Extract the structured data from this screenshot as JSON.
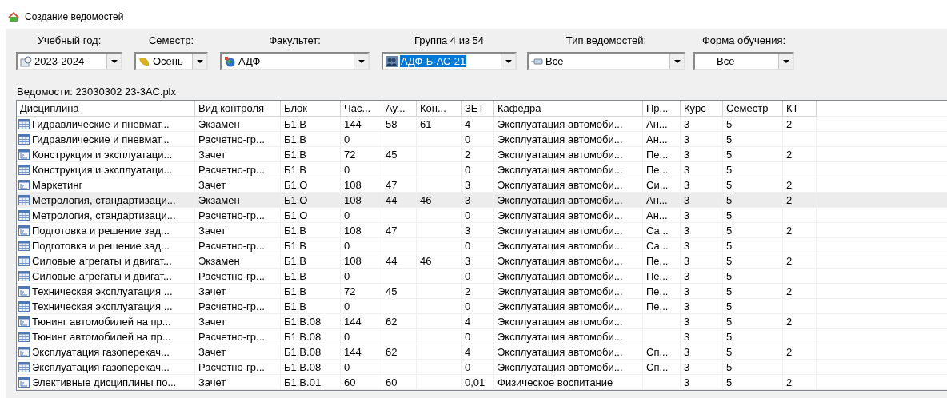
{
  "window": {
    "title": "Создание ведомостей"
  },
  "filters": {
    "year": {
      "label": "Учебный год:",
      "value": "2023-2024"
    },
    "semester": {
      "label": "Семестр:",
      "value": "Осень"
    },
    "faculty": {
      "label": "Факультет:",
      "value": "АДФ"
    },
    "group": {
      "label": "Группа 4 из 54",
      "value": "АДФ-Б-АС-21",
      "focused": true
    },
    "sheet_type": {
      "label": "Тип ведомостей:",
      "value": "Все"
    },
    "study_form": {
      "label": "Форма обучения:",
      "value": "Все"
    }
  },
  "file_caption": "Ведомости:  23030302  23-3АС.plx",
  "table": {
    "columns": [
      "Дисциплина",
      "Вид контроля",
      "Блок",
      "Час...",
      "Ау...",
      "Кон...",
      "ЗЕТ",
      "Кафедра",
      "Пр...",
      "Курс",
      "Семестр",
      "КТ"
    ],
    "rows": [
      {
        "kind": "grid",
        "selected": false,
        "cells": [
          "Гидравлические и пневмат...",
          "Экзамен",
          "Б1.В",
          "144",
          "58",
          "61",
          "4",
          "Эксплуатация автомоби...",
          "Ан...",
          "3",
          "5",
          "2"
        ]
      },
      {
        "kind": "grid",
        "selected": false,
        "cells": [
          "Гидравлические и пневмат...",
          "Расчетно-гр...",
          "Б1.В",
          "0",
          null,
          null,
          "0",
          "Эксплуатация автомоби...",
          "Ан...",
          "3",
          "5",
          null
        ]
      },
      {
        "kind": "chart",
        "selected": false,
        "cells": [
          "Конструкция и эксплуатаци...",
          "Зачет",
          "Б1.В",
          "72",
          "45",
          null,
          "2",
          "Эксплуатация автомоби...",
          "Пе...",
          "3",
          "5",
          "2"
        ]
      },
      {
        "kind": "grid",
        "selected": false,
        "cells": [
          "Конструкция и эксплуатаци...",
          "Расчетно-гр...",
          "Б1.В",
          "0",
          null,
          null,
          "0",
          "Эксплуатация автомоби...",
          "Пе...",
          "3",
          "5",
          null
        ]
      },
      {
        "kind": "chart",
        "selected": false,
        "cells": [
          "Маркетинг",
          "Зачет",
          "Б1.О",
          "108",
          "47",
          null,
          "3",
          "Эксплуатация автомоби...",
          "Си...",
          "3",
          "5",
          "2"
        ]
      },
      {
        "kind": "grid",
        "selected": true,
        "cells": [
          "Метрология, стандартизаци...",
          "Экзамен",
          "Б1.О",
          "108",
          "44",
          "46",
          "3",
          "Эксплуатация автомоби...",
          "Ан...",
          "3",
          "5",
          "2"
        ]
      },
      {
        "kind": "grid",
        "selected": false,
        "cells": [
          "Метрология, стандартизаци...",
          "Расчетно-гр...",
          "Б1.О",
          "0",
          null,
          null,
          "0",
          "Эксплуатация автомоби...",
          "Ан...",
          "3",
          "5",
          null
        ]
      },
      {
        "kind": "chart",
        "selected": false,
        "cells": [
          "Подготовка и решение зад...",
          "Зачет",
          "Б1.В",
          "108",
          "47",
          null,
          "3",
          "Эксплуатация автомоби...",
          "Са...",
          "3",
          "5",
          "2"
        ]
      },
      {
        "kind": "grid",
        "selected": false,
        "cells": [
          "Подготовка и решение зад...",
          "Расчетно-гр...",
          "Б1.В",
          "0",
          null,
          null,
          "0",
          "Эксплуатация автомоби...",
          "Са...",
          "3",
          "5",
          null
        ]
      },
      {
        "kind": "grid",
        "selected": false,
        "cells": [
          "Силовые агрегаты и двигат...",
          "Экзамен",
          "Б1.В",
          "108",
          "44",
          "46",
          "3",
          "Эксплуатация автомоби...",
          "Пе...",
          "3",
          "5",
          "2"
        ]
      },
      {
        "kind": "grid",
        "selected": false,
        "cells": [
          "Силовые агрегаты и двигат...",
          "Расчетно-гр...",
          "Б1.В",
          "0",
          null,
          null,
          "0",
          "Эксплуатация автомоби...",
          "Пе...",
          "3",
          "5",
          null
        ]
      },
      {
        "kind": "chart",
        "selected": false,
        "cells": [
          "Техническая эксплуатация ...",
          "Зачет",
          "Б1.В",
          "72",
          "45",
          null,
          "2",
          "Эксплуатация автомоби...",
          "Пе...",
          "3",
          "5",
          "2"
        ]
      },
      {
        "kind": "grid",
        "selected": false,
        "cells": [
          "Техническая эксплуатация ...",
          "Расчетно-гр...",
          "Б1.В",
          "0",
          null,
          null,
          "0",
          "Эксплуатация автомоби...",
          "Пе...",
          "3",
          "5",
          null
        ]
      },
      {
        "kind": "chart",
        "selected": false,
        "cells": [
          "Тюнинг автомобилей на пр...",
          "Зачет",
          "Б1.В.08",
          "144",
          "62",
          null,
          "4",
          "Эксплуатация автомоби...",
          null,
          "3",
          "5",
          "2"
        ]
      },
      {
        "kind": "grid",
        "selected": false,
        "cells": [
          "Тюнинг автомобилей на пр...",
          "Расчетно-гр...",
          "Б1.В.08",
          "0",
          null,
          null,
          "0",
          "Эксплуатация автомоби...",
          null,
          "3",
          "5",
          null
        ]
      },
      {
        "kind": "chart",
        "selected": false,
        "cells": [
          "Эксплуатация газоперекач...",
          "Зачет",
          "Б1.В.08",
          "144",
          "62",
          null,
          "4",
          "Эксплуатация автомоби...",
          "Сп...",
          "3",
          "5",
          "2"
        ]
      },
      {
        "kind": "grid",
        "selected": false,
        "cells": [
          "Эксплуатация газоперекач...",
          "Расчетно-гр...",
          "Б1.В.08",
          "0",
          null,
          null,
          "0",
          "Эксплуатация автомоби...",
          "Сп...",
          "3",
          "5",
          null
        ]
      },
      {
        "kind": "chart",
        "selected": false,
        "cells": [
          "Элективные дисциплины по...",
          "Зачет",
          "Б1.В.01",
          "60",
          "60",
          null,
          "0,01",
          "Физическое воспитание",
          null,
          "3",
          "5",
          "2"
        ]
      }
    ]
  }
}
